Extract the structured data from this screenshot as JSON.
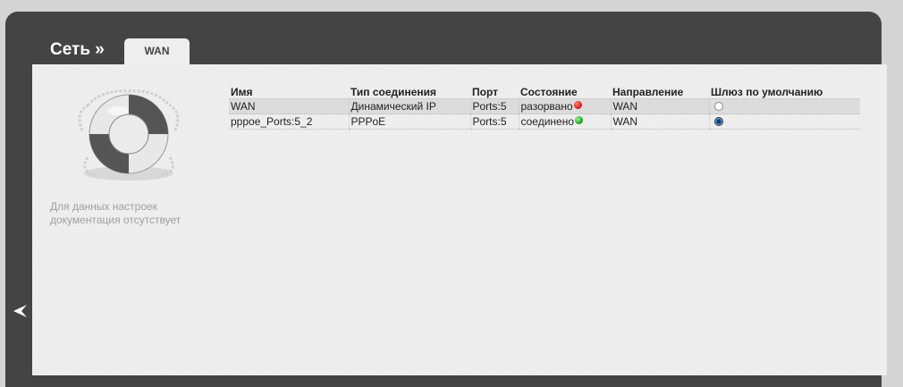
{
  "header": {
    "section": "Сеть »",
    "tab": "WAN"
  },
  "help": {
    "text": "Для данных настроек документация отсутствует",
    "icon": "lifebuoy-icon"
  },
  "table": {
    "columns": [
      "Имя",
      "Тип соединения",
      "Порт",
      "Состояние",
      "Направление",
      "Шлюз по умолчанию"
    ],
    "rows": [
      {
        "name": "WAN",
        "type": "Динамический IP",
        "port": "Ports:5",
        "status": "разорвано",
        "status_color": "#e02020",
        "direction": "WAN",
        "default_gateway": false
      },
      {
        "name": "pppoe_Ports:5_2",
        "type": "PPPoE",
        "port": "Ports:5",
        "status": "соединено",
        "status_color": "#22aa22",
        "direction": "WAN",
        "default_gateway": true
      }
    ]
  },
  "nav": {
    "back_icon": "back-arrow-icon"
  }
}
